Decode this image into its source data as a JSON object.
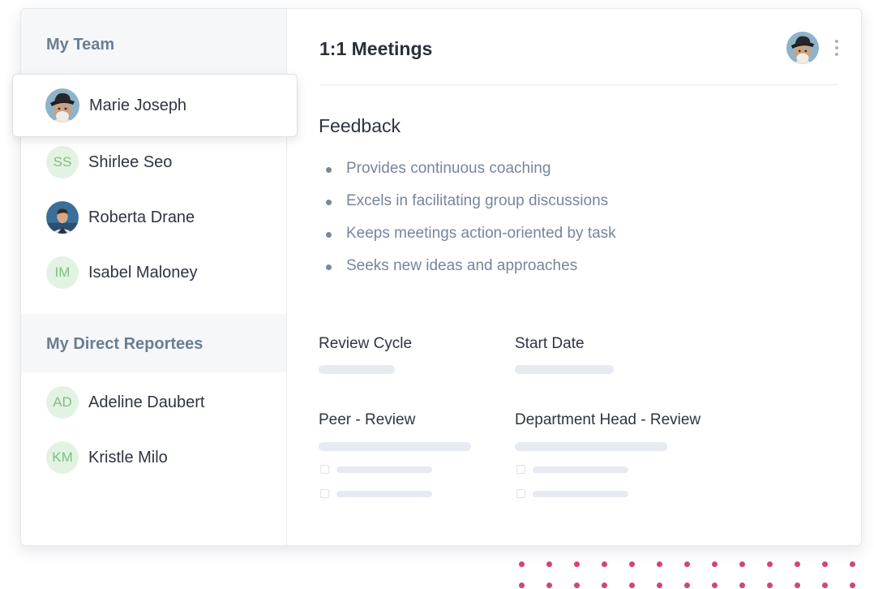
{
  "sidebar": {
    "team_heading": "My Team",
    "direct_heading": "My Direct Reportees",
    "team": [
      {
        "name": "Marie Joseph",
        "avatar": "photo-hat-man",
        "selected": true
      },
      {
        "name": "Shirlee Seo",
        "initials": "SS"
      },
      {
        "name": "Roberta Drane",
        "avatar": "photo-man"
      },
      {
        "name": "Isabel Maloney",
        "initials": "IM"
      }
    ],
    "direct": [
      {
        "name": "Adeline Daubert",
        "initials": "AD"
      },
      {
        "name": "Kristle Milo",
        "initials": "KM"
      }
    ]
  },
  "main": {
    "title": "1:1 Meetings",
    "feedback_title": "Feedback",
    "feedback": [
      "Provides continuous coaching",
      "Excels in facilitating group discussions",
      "Keeps meetings action-oriented by task",
      "Seeks new ideas and approaches"
    ],
    "fields": {
      "review_cycle": "Review Cycle",
      "start_date": "Start Date",
      "peer_review": "Peer - Review",
      "dept_head_review": "Department Head - Review"
    }
  },
  "colors": {
    "accent_dots": "#d5456f",
    "initials_bg": "#e3f3e3",
    "initials_text": "#7cc17c",
    "heading_muted": "#6b7d93"
  }
}
